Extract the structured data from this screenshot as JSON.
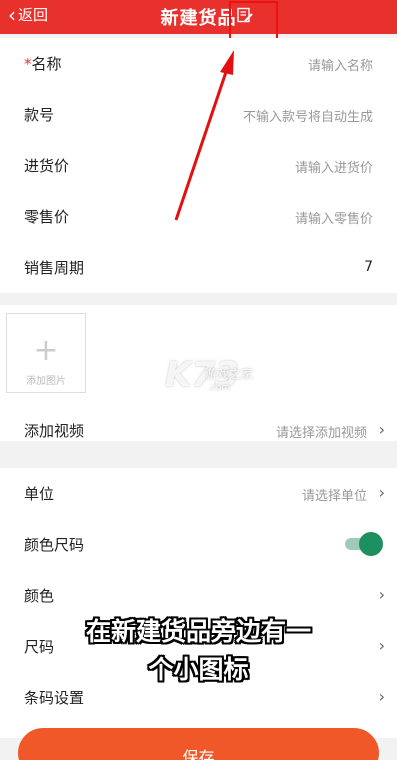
{
  "header": {
    "back_label": "返回",
    "title": "新建货品"
  },
  "fields": [
    {
      "label": "名称",
      "required_mark": "*",
      "placeholder": "请输入名称"
    },
    {
      "label": "款号",
      "placeholder": "不输入款号将自动生成"
    },
    {
      "label": "进货价",
      "placeholder": "请输入进货价"
    },
    {
      "label": "零售价",
      "placeholder": "请输入零售价"
    },
    {
      "label": "销售周期",
      "value": "7"
    }
  ],
  "photo": {
    "label": "添加图片"
  },
  "video": {
    "label": "添加视频",
    "placeholder": "请选择添加视频"
  },
  "attributes": [
    {
      "label": "单位",
      "placeholder": "请选择单位"
    },
    {
      "label": "颜色尺码",
      "toggle_on": true
    },
    {
      "label": "颜色"
    },
    {
      "label": "尺码"
    },
    {
      "label": "条码设置"
    }
  ],
  "caption": {
    "line1": "在新建货品旁边有一",
    "line2": "个小图标"
  },
  "watermark": {
    "brand": "K73",
    "sub": "游戏之家",
    "url": ".com"
  },
  "save_label": "保存",
  "colors": {
    "header": "#e8302c",
    "save": "#f0582a",
    "toggle": "#1e8f5f",
    "annotation": "#e11111"
  }
}
